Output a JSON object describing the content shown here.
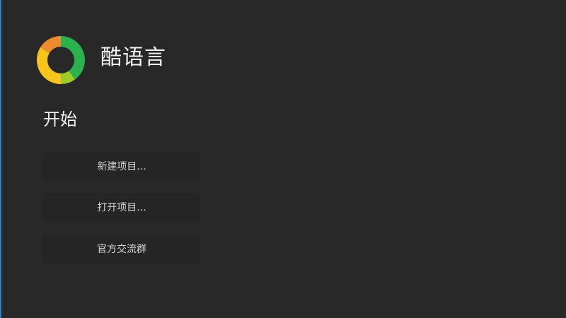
{
  "app": {
    "title": "酷语言",
    "logo_icon": "ring-logo-icon",
    "logo_colors": [
      "#2bb24c",
      "#9ccc2a",
      "#f6c51c",
      "#f08a2e"
    ]
  },
  "start": {
    "heading": "开始",
    "actions": [
      {
        "label": "新建项目..."
      },
      {
        "label": "打开项目..."
      },
      {
        "label": "官方交流群"
      }
    ]
  },
  "colors": {
    "background": "#282828",
    "button_background": "#252525",
    "left_edge_accent": "#3a7fb8"
  }
}
